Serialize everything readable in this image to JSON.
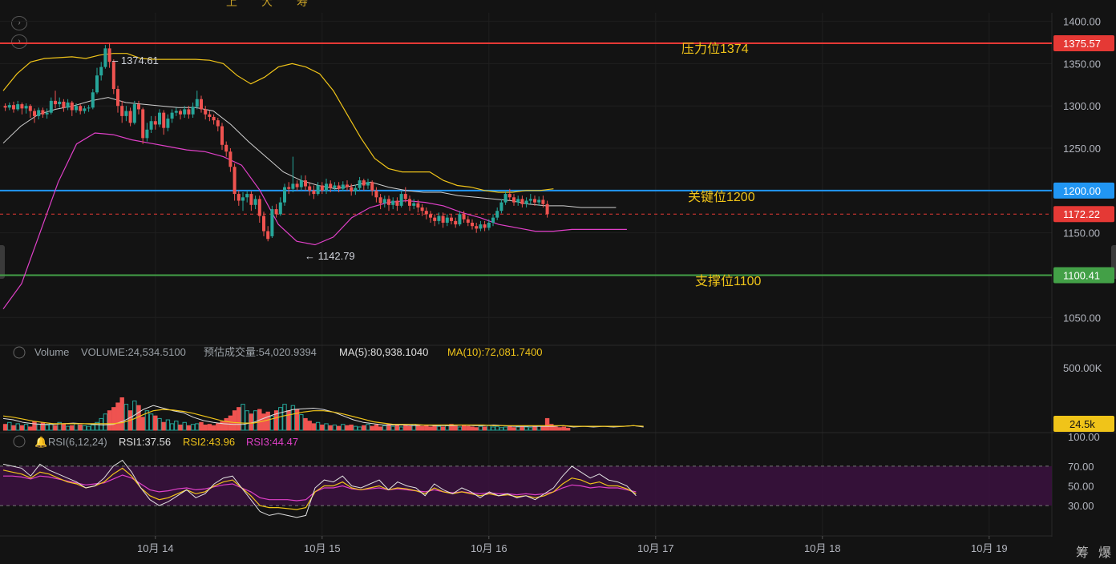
{
  "toolbar": {
    "glyphs": [
      "上",
      "大",
      "寿"
    ]
  },
  "price_pane": {
    "lines": [
      {
        "label": "压力位1374",
        "value": 1374,
        "tag": "1375.57",
        "color": "#e53935",
        "style": "solid"
      },
      {
        "label": "关键位1200",
        "value": 1200,
        "tag": "1200.00",
        "color": "#2196f3",
        "style": "solid"
      },
      {
        "label": "支撑位1100",
        "value": 1100,
        "tag": "1100.41",
        "color": "#43a047",
        "style": "solid"
      },
      {
        "label": "",
        "value": 1172.22,
        "tag": "1172.22",
        "color": "#e53935",
        "style": "dashed"
      }
    ],
    "high_marker": "1374.61",
    "low_marker": "1142.79",
    "label_color": "#f0c419"
  },
  "volume_pane": {
    "title": "Volume",
    "volume_text": "VOLUME:24,534.5100",
    "est_text": "预估成交量:54,020.9394",
    "ma5_text": "MA(5):80,938.1040",
    "ma10_text": "MA(10):72,081.7400",
    "tag": "24.5k",
    "axis_top": "500.00K"
  },
  "rsi_pane": {
    "title": "RSI(6,12,24)",
    "rsi1_text": "RSI1:37.56",
    "rsi2_text": "RSI2:43.96",
    "rsi3_text": "RSI3:44.47",
    "colors": {
      "rsi1": "#e0e0e0",
      "rsi2": "#f0c419",
      "rsi3": "#e040c8"
    }
  },
  "bottom_right": {
    "left": "筹",
    "right": "爆"
  },
  "chart_data": {
    "type": "candlestick",
    "colors": {
      "up": "#26a69a",
      "down": "#ef5350",
      "band": "#f0c419",
      "band_mid": "#d0d0d0",
      "band_low": "#e040c8"
    },
    "price_axis": {
      "ylim": [
        1020,
        1410
      ],
      "ticks": [
        "1400.00",
        "1350.00",
        "1300.00",
        "1250.00",
        "1200.00",
        "1150.00",
        "1100.00",
        "1050.00"
      ]
    },
    "volume_axis": {
      "ylim": [
        0,
        520000
      ]
    },
    "rsi_axis": {
      "ylim": [
        0,
        100
      ],
      "ticks": [
        "100.00",
        "70.00",
        "50.00",
        "30.00"
      ],
      "band": [
        30,
        70
      ]
    },
    "x_ticks": [
      "10月 14",
      "10月 15",
      "10月 16",
      "10月 17",
      "10月 18",
      "10月 19"
    ],
    "x_tick_index": [
      36,
      76,
      116,
      156,
      196,
      236
    ],
    "candles": [
      [
        1300,
        1298,
        1303,
        1294
      ],
      [
        1298,
        1301,
        1304,
        1295
      ],
      [
        1301,
        1296,
        1305,
        1292
      ],
      [
        1296,
        1302,
        1306,
        1294
      ],
      [
        1302,
        1297,
        1304,
        1290
      ],
      [
        1297,
        1300,
        1303,
        1291
      ],
      [
        1300,
        1294,
        1302,
        1286
      ],
      [
        1294,
        1288,
        1297,
        1280
      ],
      [
        1288,
        1295,
        1298,
        1284
      ],
      [
        1295,
        1290,
        1298,
        1286
      ],
      [
        1290,
        1292,
        1297,
        1285
      ],
      [
        1292,
        1306,
        1310,
        1290
      ],
      [
        1306,
        1302,
        1318,
        1297
      ],
      [
        1302,
        1305,
        1310,
        1298
      ],
      [
        1305,
        1298,
        1308,
        1293
      ],
      [
        1298,
        1304,
        1308,
        1295
      ],
      [
        1304,
        1295,
        1306,
        1288
      ],
      [
        1295,
        1300,
        1303,
        1292
      ],
      [
        1300,
        1294,
        1302,
        1290
      ],
      [
        1294,
        1297,
        1300,
        1291
      ],
      [
        1297,
        1298,
        1301,
        1293
      ],
      [
        1298,
        1316,
        1320,
        1296
      ],
      [
        1316,
        1336,
        1345,
        1314
      ],
      [
        1336,
        1346,
        1352,
        1330
      ],
      [
        1346,
        1368,
        1372,
        1344
      ],
      [
        1368,
        1352,
        1374.61,
        1345
      ],
      [
        1352,
        1320,
        1355,
        1314
      ],
      [
        1320,
        1300,
        1324,
        1292
      ],
      [
        1300,
        1288,
        1306,
        1280
      ],
      [
        1288,
        1294,
        1300,
        1282
      ],
      [
        1294,
        1280,
        1298,
        1276
      ],
      [
        1280,
        1302,
        1306,
        1278
      ],
      [
        1302,
        1296,
        1306,
        1290
      ],
      [
        1296,
        1262,
        1298,
        1255
      ],
      [
        1262,
        1272,
        1280,
        1258
      ],
      [
        1272,
        1282,
        1288,
        1268
      ],
      [
        1282,
        1278,
        1288,
        1272
      ],
      [
        1278,
        1292,
        1296,
        1275
      ],
      [
        1292,
        1274,
        1295,
        1266
      ],
      [
        1274,
        1285,
        1290,
        1270
      ],
      [
        1285,
        1292,
        1296,
        1280
      ],
      [
        1292,
        1294,
        1298,
        1288
      ],
      [
        1294,
        1290,
        1296,
        1284
      ],
      [
        1290,
        1296,
        1300,
        1286
      ],
      [
        1296,
        1290,
        1300,
        1285
      ],
      [
        1290,
        1299,
        1304,
        1286
      ],
      [
        1299,
        1308,
        1318,
        1296
      ],
      [
        1308,
        1296,
        1312,
        1292
      ],
      [
        1296,
        1290,
        1300,
        1284
      ],
      [
        1290,
        1287,
        1294,
        1282
      ],
      [
        1287,
        1283,
        1290,
        1278
      ],
      [
        1283,
        1276,
        1286,
        1270
      ],
      [
        1276,
        1254,
        1280,
        1248
      ],
      [
        1254,
        1246,
        1258,
        1240
      ],
      [
        1246,
        1228,
        1250,
        1222
      ],
      [
        1228,
        1196,
        1232,
        1188
      ],
      [
        1196,
        1188,
        1200,
        1182
      ],
      [
        1188,
        1192,
        1198,
        1176
      ],
      [
        1192,
        1196,
        1200,
        1186
      ],
      [
        1196,
        1183,
        1199,
        1176
      ],
      [
        1183,
        1190,
        1194,
        1178
      ],
      [
        1190,
        1170,
        1194,
        1162
      ],
      [
        1170,
        1152,
        1175,
        1146
      ],
      [
        1152,
        1142.79,
        1158,
        1140
      ],
      [
        1146,
        1178,
        1182,
        1144
      ],
      [
        1178,
        1172,
        1184,
        1168
      ],
      [
        1172,
        1186,
        1192,
        1170
      ],
      [
        1186,
        1204,
        1208,
        1182
      ],
      [
        1204,
        1202,
        1210,
        1196
      ],
      [
        1202,
        1208,
        1240,
        1198
      ],
      [
        1208,
        1204,
        1212,
        1200
      ],
      [
        1204,
        1212,
        1218,
        1200
      ],
      [
        1212,
        1205,
        1218,
        1200
      ],
      [
        1205,
        1200,
        1210,
        1194
      ],
      [
        1200,
        1196,
        1206,
        1190
      ],
      [
        1196,
        1206,
        1210,
        1194
      ],
      [
        1206,
        1200,
        1210,
        1196
      ],
      [
        1200,
        1208,
        1214,
        1196
      ],
      [
        1208,
        1203,
        1212,
        1198
      ],
      [
        1203,
        1206,
        1210,
        1200
      ],
      [
        1206,
        1202,
        1210,
        1198
      ],
      [
        1202,
        1207,
        1211,
        1199
      ],
      [
        1207,
        1204,
        1212,
        1200
      ],
      [
        1204,
        1199,
        1208,
        1194
      ],
      [
        1199,
        1203,
        1207,
        1195
      ],
      [
        1203,
        1212,
        1216,
        1200
      ],
      [
        1212,
        1206,
        1214,
        1200
      ],
      [
        1206,
        1210,
        1214,
        1202
      ],
      [
        1210,
        1200,
        1212,
        1194
      ],
      [
        1200,
        1192,
        1204,
        1186
      ],
      [
        1192,
        1185,
        1196,
        1178
      ],
      [
        1185,
        1190,
        1194,
        1180
      ],
      [
        1190,
        1183,
        1194,
        1176
      ],
      [
        1183,
        1188,
        1192,
        1178
      ],
      [
        1188,
        1182,
        1192,
        1176
      ],
      [
        1182,
        1196,
        1200,
        1180
      ],
      [
        1196,
        1190,
        1204,
        1186
      ],
      [
        1190,
        1182,
        1194,
        1176
      ],
      [
        1182,
        1185,
        1190,
        1178
      ],
      [
        1185,
        1180,
        1189,
        1174
      ],
      [
        1180,
        1176,
        1184,
        1170
      ],
      [
        1176,
        1172,
        1180,
        1166
      ],
      [
        1172,
        1168,
        1176,
        1162
      ],
      [
        1168,
        1164,
        1172,
        1158
      ],
      [
        1164,
        1170,
        1174,
        1160
      ],
      [
        1170,
        1162,
        1174,
        1156
      ],
      [
        1162,
        1168,
        1172,
        1158
      ],
      [
        1168,
        1164,
        1172,
        1160
      ],
      [
        1164,
        1160,
        1168,
        1156
      ],
      [
        1160,
        1172,
        1176,
        1158
      ],
      [
        1172,
        1166,
        1176,
        1162
      ],
      [
        1166,
        1162,
        1170,
        1158
      ],
      [
        1162,
        1158,
        1166,
        1154
      ],
      [
        1158,
        1155,
        1162,
        1150
      ],
      [
        1155,
        1160,
        1164,
        1152
      ],
      [
        1160,
        1156,
        1164,
        1152
      ],
      [
        1156,
        1162,
        1166,
        1153
      ],
      [
        1162,
        1168,
        1172,
        1158
      ],
      [
        1168,
        1176,
        1180,
        1165
      ],
      [
        1176,
        1186,
        1190,
        1173
      ],
      [
        1186,
        1196,
        1200,
        1183
      ],
      [
        1196,
        1192,
        1202,
        1188
      ],
      [
        1192,
        1186,
        1196,
        1182
      ],
      [
        1186,
        1190,
        1194,
        1182
      ],
      [
        1190,
        1184,
        1194,
        1180
      ],
      [
        1184,
        1188,
        1192,
        1180
      ],
      [
        1188,
        1190,
        1196,
        1184
      ],
      [
        1190,
        1186,
        1194,
        1182
      ],
      [
        1186,
        1189,
        1193,
        1182
      ],
      [
        1189,
        1184,
        1194,
        1180
      ],
      [
        1184,
        1172.22,
        1188,
        1168
      ]
    ],
    "bands": {
      "upper": [
        1318,
        1338,
        1352,
        1356,
        1357,
        1358,
        1356,
        1360,
        1362,
        1362,
        1356,
        1355,
        1355,
        1355,
        1355,
        1354,
        1350,
        1336,
        1326,
        1334,
        1346,
        1350,
        1346,
        1338,
        1318,
        1290,
        1262,
        1238,
        1226,
        1222,
        1222,
        1222,
        1212,
        1206,
        1204,
        1200,
        1198,
        1198,
        1200,
        1200,
        1202
      ],
      "mid": [
        1256,
        1276,
        1290,
        1296,
        1300,
        1306,
        1310,
        1304,
        1302,
        1300,
        1298,
        1298,
        1294,
        1278,
        1258,
        1240,
        1222,
        1212,
        1206,
        1202,
        1206,
        1210,
        1204,
        1200,
        1198,
        1198,
        1194,
        1192,
        1190,
        1188,
        1184,
        1182,
        1182,
        1180,
        1180,
        1180
      ],
      "lower": [
        1060,
        1090,
        1150,
        1210,
        1255,
        1268,
        1266,
        1260,
        1256,
        1252,
        1248,
        1246,
        1240,
        1230,
        1200,
        1160,
        1140,
        1136,
        1145,
        1168,
        1180,
        1186,
        1188,
        1186,
        1182,
        1174,
        1168,
        1160,
        1156,
        1152,
        1152,
        1154,
        1154,
        1154,
        1154
      ]
    },
    "volume": [
      0.09,
      0.12,
      0.07,
      0.1,
      0.07,
      0.09,
      0.05,
      0.13,
      0.09,
      0.11,
      0.08,
      0.1,
      0.07,
      0.12,
      0.09,
      0.06,
      0.07,
      0.1,
      0.08,
      0.07,
      0.06,
      0.08,
      0.12,
      0.18,
      0.25,
      0.3,
      0.35,
      0.42,
      0.5,
      0.4,
      0.3,
      0.45,
      0.38,
      0.2,
      0.3,
      0.25,
      0.22,
      0.18,
      0.12,
      0.16,
      0.1,
      0.14,
      0.08,
      0.12,
      0.07,
      0.09,
      0.1,
      0.12,
      0.08,
      0.09,
      0.07,
      0.1,
      0.13,
      0.18,
      0.22,
      0.3,
      0.35,
      0.4,
      0.3,
      0.25,
      0.3,
      0.32,
      0.25,
      0.28,
      0.22,
      0.3,
      0.35,
      0.4,
      0.3,
      0.38,
      0.32,
      0.24,
      0.18,
      0.14,
      0.1,
      0.12,
      0.08,
      0.1,
      0.07,
      0.08,
      0.06,
      0.09,
      0.07,
      0.08,
      0.06,
      0.05,
      0.07,
      0.09,
      0.06,
      0.08,
      0.05,
      0.07,
      0.09,
      0.06,
      0.08,
      0.05,
      0.07,
      0.06,
      0.09,
      0.07,
      0.06,
      0.08,
      0.05,
      0.07,
      0.06,
      0.05,
      0.07,
      0.09,
      0.06,
      0.05,
      0.07,
      0.06,
      0.05,
      0.04,
      0.06,
      0.05,
      0.07,
      0.05,
      0.06,
      0.04,
      0.05,
      0.06,
      0.04,
      0.05,
      0.06,
      0.05,
      0.04,
      0.05,
      0.06,
      0.05,
      0.18,
      0.09,
      0.05,
      0.04,
      0.05,
      0.03
    ],
    "vol_ma5": [
      0.18,
      0.16,
      0.12,
      0.1,
      0.09,
      0.09,
      0.1,
      0.11,
      0.1,
      0.09,
      0.08,
      0.09,
      0.14,
      0.22,
      0.32,
      0.38,
      0.34,
      0.3,
      0.27,
      0.2,
      0.15,
      0.12,
      0.1,
      0.09,
      0.09,
      0.12,
      0.18,
      0.24,
      0.28,
      0.32,
      0.33,
      0.34,
      0.32,
      0.28,
      0.22,
      0.16,
      0.12,
      0.1,
      0.08,
      0.08,
      0.08,
      0.07,
      0.08,
      0.07,
      0.07,
      0.07,
      0.08,
      0.07,
      0.07,
      0.08,
      0.07,
      0.06,
      0.06,
      0.06,
      0.06,
      0.06,
      0.07,
      0.05,
      0.06,
      0.05,
      0.06,
      0.05,
      0.06,
      0.07,
      0.05
    ],
    "vol_ma10": [
      0.22,
      0.2,
      0.17,
      0.14,
      0.12,
      0.1,
      0.1,
      0.1,
      0.1,
      0.1,
      0.1,
      0.1,
      0.12,
      0.17,
      0.24,
      0.3,
      0.32,
      0.31,
      0.29,
      0.26,
      0.22,
      0.18,
      0.14,
      0.12,
      0.11,
      0.11,
      0.14,
      0.18,
      0.22,
      0.25,
      0.28,
      0.3,
      0.3,
      0.28,
      0.25,
      0.21,
      0.17,
      0.13,
      0.11,
      0.09,
      0.09,
      0.09,
      0.08,
      0.08,
      0.08,
      0.08,
      0.08,
      0.08,
      0.08,
      0.07,
      0.07,
      0.07,
      0.07,
      0.07,
      0.07,
      0.07,
      0.07,
      0.06,
      0.06,
      0.06,
      0.06,
      0.06,
      0.06,
      0.07,
      0.06
    ],
    "rsi1": [
      72,
      70,
      68,
      60,
      72,
      66,
      62,
      58,
      54,
      48,
      50,
      58,
      70,
      76,
      64,
      48,
      36,
      30,
      34,
      40,
      46,
      38,
      42,
      52,
      58,
      60,
      48,
      36,
      24,
      20,
      22,
      20,
      18,
      20,
      48,
      56,
      54,
      60,
      50,
      48,
      52,
      56,
      46,
      54,
      50,
      48,
      40,
      52,
      46,
      42,
      48,
      44,
      38,
      44,
      40,
      42,
      38,
      40,
      36,
      42,
      48,
      60,
      70,
      64,
      58,
      62,
      56,
      54,
      50,
      40
    ],
    "rsi2": [
      66,
      64,
      62,
      58,
      64,
      62,
      58,
      54,
      52,
      48,
      50,
      54,
      62,
      68,
      60,
      48,
      40,
      36,
      38,
      42,
      46,
      42,
      44,
      50,
      54,
      56,
      48,
      40,
      30,
      28,
      28,
      27,
      26,
      28,
      44,
      50,
      50,
      54,
      48,
      46,
      48,
      50,
      46,
      48,
      47,
      45,
      42,
      48,
      44,
      42,
      44,
      42,
      40,
      42,
      40,
      41,
      39,
      40,
      38,
      40,
      44,
      52,
      58,
      56,
      52,
      54,
      50,
      50,
      47,
      42
    ],
    "rsi3": [
      60,
      60,
      59,
      57,
      60,
      59,
      57,
      55,
      53,
      51,
      52,
      53,
      57,
      61,
      58,
      52,
      46,
      44,
      45,
      47,
      48,
      46,
      47,
      49,
      51,
      52,
      48,
      44,
      38,
      36,
      36,
      36,
      35,
      36,
      44,
      48,
      48,
      50,
      47,
      46,
      47,
      48,
      46,
      47,
      46,
      45,
      44,
      46,
      44,
      43,
      44,
      43,
      42,
      43,
      42,
      42,
      41,
      42,
      41,
      42,
      44,
      48,
      51,
      50,
      48,
      49,
      48,
      48,
      46,
      44
    ]
  }
}
